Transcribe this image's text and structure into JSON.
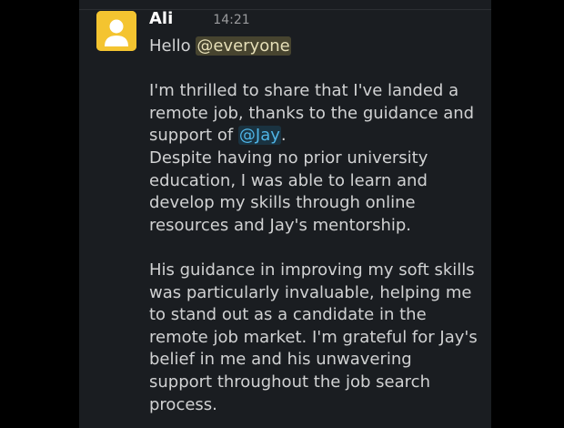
{
  "message": {
    "author": "Ali",
    "time": "14:21",
    "avatar_icon": "user-avatar-icon",
    "greeting": {
      "text": "Hello ",
      "mention": "@everyone"
    },
    "paragraph1": {
      "line1": "I'm thrilled to share that I've landed a",
      "line2": "remote job, thanks to the guidance and",
      "line3_pre": "support of ",
      "line3_mention": "@Jay",
      "line3_post": ".",
      "line4": "Despite having no prior university",
      "line5": "education, I was able to learn and",
      "line6": "develop my skills through online",
      "line7": "resources and Jay's mentorship."
    },
    "paragraph2": {
      "line1": "His guidance in improving my soft skills",
      "line2": "was particularly invaluable, helping me",
      "line3": "to stand out as a candidate in the",
      "line4": "remote job market. I'm grateful for Jay's",
      "line5": "belief in me and his unwavering",
      "line6": "support throughout the job search",
      "line7": "process."
    }
  },
  "colors": {
    "background": "#1a1d21",
    "avatar_background": "#f4c430",
    "mention_everyone_highlight": "#e8d264",
    "mention_user_text": "#4fb4e6"
  }
}
